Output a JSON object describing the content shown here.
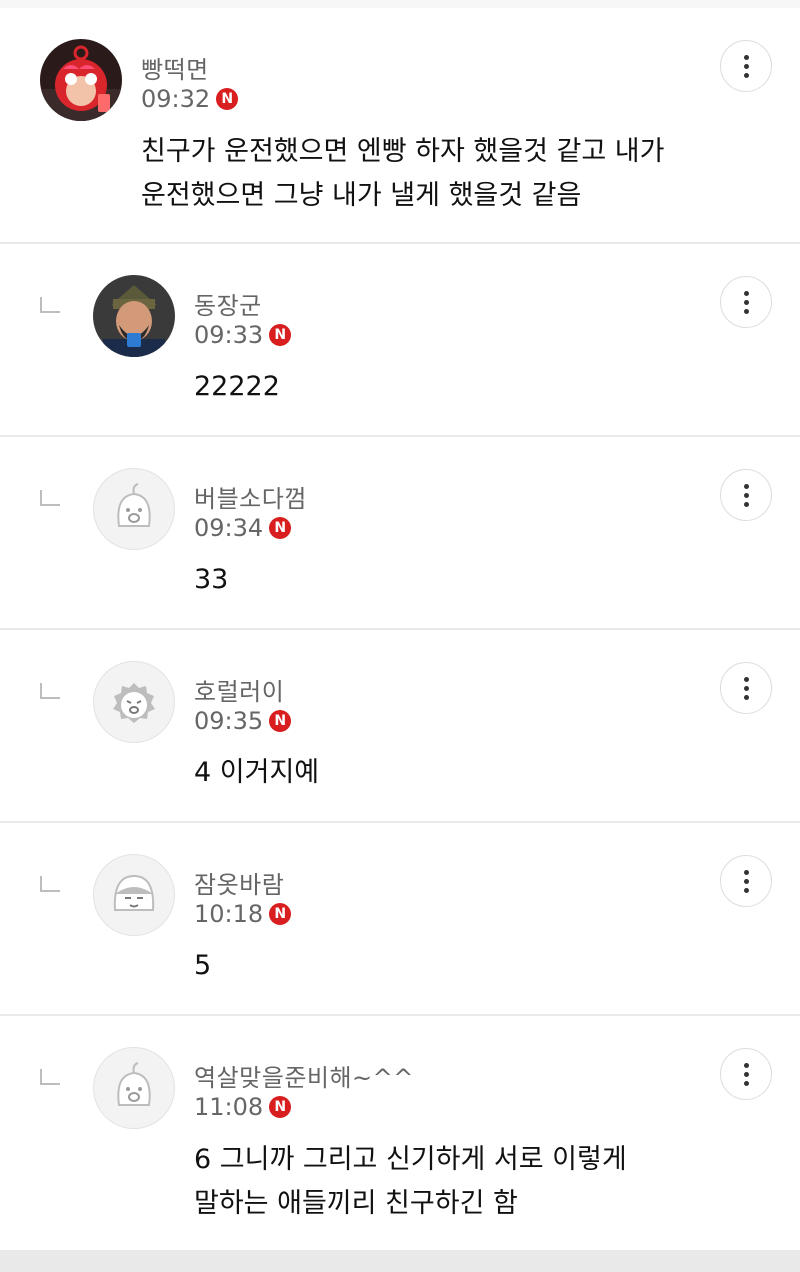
{
  "comments": [
    {
      "nick": "빵떡면",
      "time": "09:32",
      "badge": "N",
      "lines": [
        "친구가 운전했으면 엔빵 하자 했을것 같고 내가",
        "운전했으면 그냥 내가 낼게 했을것 같음"
      ],
      "avatar_icon": "red-monkey-avatar-icon"
    },
    {
      "nick": "동장군",
      "time": "09:33",
      "badge": "N",
      "lines": [
        "22222"
      ],
      "avatar_icon": "general-costume-avatar-icon"
    },
    {
      "nick": "버블소다껌",
      "time": "09:34",
      "badge": "N",
      "lines": [
        "33"
      ],
      "avatar_icon": "default-character-avatar-icon"
    },
    {
      "nick": "호럴러이",
      "time": "09:35",
      "badge": "N",
      "lines": [
        "4 이거지예"
      ],
      "avatar_icon": "default-character-avatar-icon"
    },
    {
      "nick": "잠옷바람",
      "time": "10:18",
      "badge": "N",
      "lines": [
        "5"
      ],
      "avatar_icon": "default-character-avatar-icon"
    },
    {
      "nick": "역살맞을준비해~^^",
      "time": "11:08",
      "badge": "N",
      "lines": [
        "6 그니까 그리고 신기하게 서로 이렇게",
        "말하는 애들끼리 친구하긴 함"
      ],
      "avatar_icon": "default-character-avatar-icon"
    }
  ],
  "colors": {
    "badge": "#d81e1e",
    "text": "#111111",
    "meta": "#666666",
    "divider": "#e9e9ea"
  }
}
